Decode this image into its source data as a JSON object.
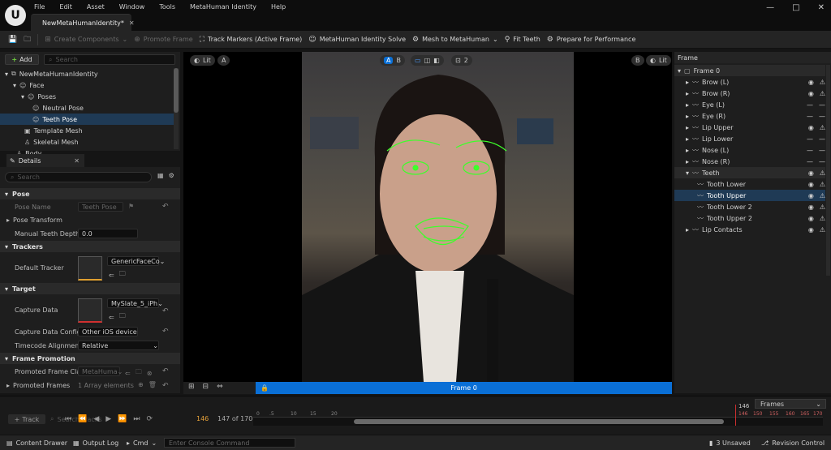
{
  "window": {
    "menu": [
      "File",
      "Edit",
      "Asset",
      "Window",
      "Tools",
      "MetaHuman Identity",
      "Help"
    ],
    "tab_label": "NewMetaHumanIdentity*",
    "controls": [
      "—",
      "□",
      "✕"
    ]
  },
  "toolbar": {
    "create_components": "Create Components",
    "promote_frame": "Promote Frame",
    "track_markers": "Track Markers (Active Frame)",
    "identity_solve": "MetaHuman Identity Solve",
    "mesh_to_metahuman": "Mesh to MetaHuman",
    "fit_teeth": "Fit Teeth",
    "prepare_performance": "Prepare for Performance"
  },
  "outliner": {
    "add_label": "Add",
    "search_placeholder": "Search",
    "items": [
      {
        "label": "NewMetaHumanIdentity",
        "indent": 0
      },
      {
        "label": "Face",
        "indent": 1
      },
      {
        "label": "Poses",
        "indent": 2
      },
      {
        "label": "Neutral Pose",
        "indent": 3
      },
      {
        "label": "Teeth Pose",
        "indent": 3
      },
      {
        "label": "Template Mesh",
        "indent": 2
      },
      {
        "label": "Skeletal Mesh",
        "indent": 2
      },
      {
        "label": "Body",
        "indent": 1
      }
    ],
    "selected_index": 4
  },
  "details": {
    "tab_label": "Details",
    "search_placeholder": "Search",
    "pose_section": "Pose",
    "pose_name_label": "Pose Name",
    "pose_name_value": "Teeth Pose",
    "pose_transform_label": "Pose Transform",
    "manual_teeth_label": "Manual Teeth Depth...",
    "manual_teeth_value": "0.0",
    "trackers_section": "Trackers",
    "default_tracker_label": "Default Tracker",
    "default_tracker_value": "GenericFaceCo",
    "target_section": "Target",
    "capture_data_label": "Capture Data",
    "capture_data_value": "MySlate_5_iPh",
    "capture_config_label": "Capture Data Config",
    "capture_config_value": "Other iOS device",
    "timecode_label": "Timecode Alignment",
    "timecode_value": "Relative",
    "frame_promotion_section": "Frame Promotion",
    "promoted_class_label": "Promoted Frame Cla...",
    "promoted_class_value": "MetaHuma",
    "promoted_frames_label": "Promoted Frames",
    "promoted_frames_value": "1 Array elements"
  },
  "viewport": {
    "lit_left": "Lit",
    "view_a": "A",
    "ab_a": "A",
    "ab_b": "B",
    "cam_count": "2",
    "view_b": "B",
    "lit_right": "Lit",
    "frame_label": "Frame 0"
  },
  "frame_panel": {
    "title": "Frame",
    "rows": [
      {
        "label": "Frame 0",
        "indent": 0,
        "eye": false,
        "lock": false,
        "kind": "root"
      },
      {
        "label": "Brow (L)",
        "indent": 1,
        "eye": true,
        "lock": true
      },
      {
        "label": "Brow (R)",
        "indent": 1,
        "eye": true,
        "lock": true
      },
      {
        "label": "Eye (L)",
        "indent": 1,
        "eye": false,
        "lock": false
      },
      {
        "label": "Eye (R)",
        "indent": 1,
        "eye": false,
        "lock": false
      },
      {
        "label": "Lip Upper",
        "indent": 1,
        "eye": true,
        "lock": true
      },
      {
        "label": "Lip Lower",
        "indent": 1,
        "eye": false,
        "lock": false
      },
      {
        "label": "Nose (L)",
        "indent": 1,
        "eye": false,
        "lock": false
      },
      {
        "label": "Nose (R)",
        "indent": 1,
        "eye": false,
        "lock": false
      },
      {
        "label": "Teeth",
        "indent": 1,
        "eye": true,
        "lock": true,
        "kind": "group"
      },
      {
        "label": "Tooth Lower",
        "indent": 2,
        "eye": true,
        "lock": true
      },
      {
        "label": "Tooth Upper",
        "indent": 2,
        "eye": true,
        "lock": true,
        "kind": "selected"
      },
      {
        "label": "Tooth Lower 2",
        "indent": 2,
        "eye": true,
        "lock": true
      },
      {
        "label": "Tooth Upper 2",
        "indent": 2,
        "eye": true,
        "lock": true
      },
      {
        "label": "Lip Contacts",
        "indent": 1,
        "eye": true,
        "lock": true
      }
    ]
  },
  "timeline": {
    "track_label": "Track",
    "search_placeholder": "Search Tracks",
    "current_frame": "146",
    "frame_count": "147 of 170",
    "frames_dropdown": "Frames",
    "ruler_labels": [
      "0",
      ".5",
      "10",
      "15",
      "20",
      "146",
      "150",
      "155",
      "160",
      "165",
      "170"
    ],
    "playhead_label": "146"
  },
  "statusbar": {
    "content_drawer": "Content Drawer",
    "output_log": "Output Log",
    "cmd": "Cmd",
    "console_placeholder": "Enter Console Command",
    "unsaved": "3 Unsaved",
    "revision": "Revision Control"
  },
  "colors": {
    "accent": "#0a6fd6",
    "selection": "#1f3a55",
    "tracker": "#3dff2a",
    "playhead": "#e8a33a"
  }
}
